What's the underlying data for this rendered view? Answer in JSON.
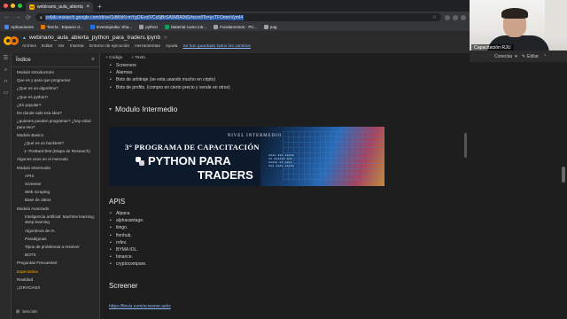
{
  "browser": {
    "tab_title": "webinario_aula_abierta_pytho...",
    "new_tab": "+",
    "url": "colab.research.google.com/drive/1dWvKt-mYgOEvoIVCs5jBrSA0kBA0tiS#scrollTo=ycTFOmmVymI4",
    "bookmarks": [
      {
        "label": "Aplicaciones",
        "color": "#4285f4"
      },
      {
        "label": "Teoría - Espacio d...",
        "color": "#e37400"
      },
      {
        "label": "Investopedia: Sha...",
        "color": "#1a73e8"
      },
      {
        "label": "python",
        "color": "#9aa0a6"
      },
      {
        "label": "Material curso intr...",
        "color": "#0f9d58"
      },
      {
        "label": "Fundamentos - Pri...",
        "color": "#9aa0a6"
      },
      {
        "label": "pag",
        "color": "#9aa0a6"
      }
    ]
  },
  "colab": {
    "notebook_title": "webinario_aula_abierta_python_para_traders.ipynb",
    "menus": [
      "Archivo",
      "Editar",
      "Ver",
      "Insertar",
      "Entorno de ejecución",
      "Herramientas",
      "Ayuda"
    ],
    "saved_status": "Se han guardado todos los cambios",
    "connect_label": "Conectar",
    "edit_label": "Editar"
  },
  "webcam": {
    "label": "Capacitación RJU"
  },
  "sidebar": {
    "title": "Índice",
    "footer": "Sección",
    "items": [
      {
        "label": "Modulo Introductorio",
        "level": 1
      },
      {
        "label": "Que es y para que programar",
        "level": 1
      },
      {
        "label": "¿Que es un algoritmo?",
        "level": 1
      },
      {
        "label": "¿Que es python?",
        "level": 1
      },
      {
        "label": "¿Es popular?",
        "level": 1
      },
      {
        "label": "De donde sale esa idea?",
        "level": 1
      },
      {
        "label": "¿quienes pueden programar? ¿hay edad para eso?",
        "level": 1
      },
      {
        "label": "Modulo Basico",
        "level": 1
      },
      {
        "label": "¿Qué es un backtest?",
        "level": 2
      },
      {
        "label": "1- PreBackTest (Etapa de Research)",
        "level": 2
      },
      {
        "label": "Algunos usos en el mercado",
        "level": 1
      },
      {
        "label": "Modulo Intermedio",
        "level": 1
      },
      {
        "label": "APIS",
        "level": 3
      },
      {
        "label": "Screener",
        "level": 3
      },
      {
        "label": "Web scraping",
        "level": 3
      },
      {
        "label": "Base de datos",
        "level": 3
      },
      {
        "label": "Modulo Avanzado",
        "level": 1
      },
      {
        "label": "Inteligencia artificial: Machine learning, deep learning",
        "level": 3
      },
      {
        "label": "Algoritmos de IA",
        "level": 3
      },
      {
        "label": "Paradigmas",
        "level": 3
      },
      {
        "label": "Tipos de problemas a resolver",
        "level": 3
      },
      {
        "label": "BOTS",
        "level": 3
      },
      {
        "label": "Preguntas Frecuentes:",
        "level": 1
      },
      {
        "label": "Expectativa",
        "level": 1,
        "active": true
      },
      {
        "label": "Realidad",
        "level": 1
      },
      {
        "label": "¡¡GRACIAS!!",
        "level": 1
      }
    ]
  },
  "toolbar": {
    "code": "+ Código",
    "text": "+ Texto"
  },
  "cells": {
    "top_bullets": [
      "Screeners",
      "Alarmas",
      "Bots de arbitraje (se esta usando mucho en cripto)",
      "Bots de profits. (compro en cierto precio y vende en otros)"
    ],
    "section_title": "Modulo Intermedio",
    "banner": {
      "line1": "NIVEL INTERMEDIO",
      "line2": "3° PROGRAMA DE CAPACITACIÓN",
      "line3": "PYTHON PARA",
      "line4": "TRADERS"
    },
    "apis_title": "APIS",
    "apis_items": [
      "Alpaca.",
      "alphavantage.",
      "tiingo.",
      "finnhub.",
      "rofex.",
      "BYMA IOL.",
      "binance.",
      "cryptocompare."
    ],
    "screener_title": "Screener",
    "screener_link": "https://finviz.com/screener.ashx"
  }
}
